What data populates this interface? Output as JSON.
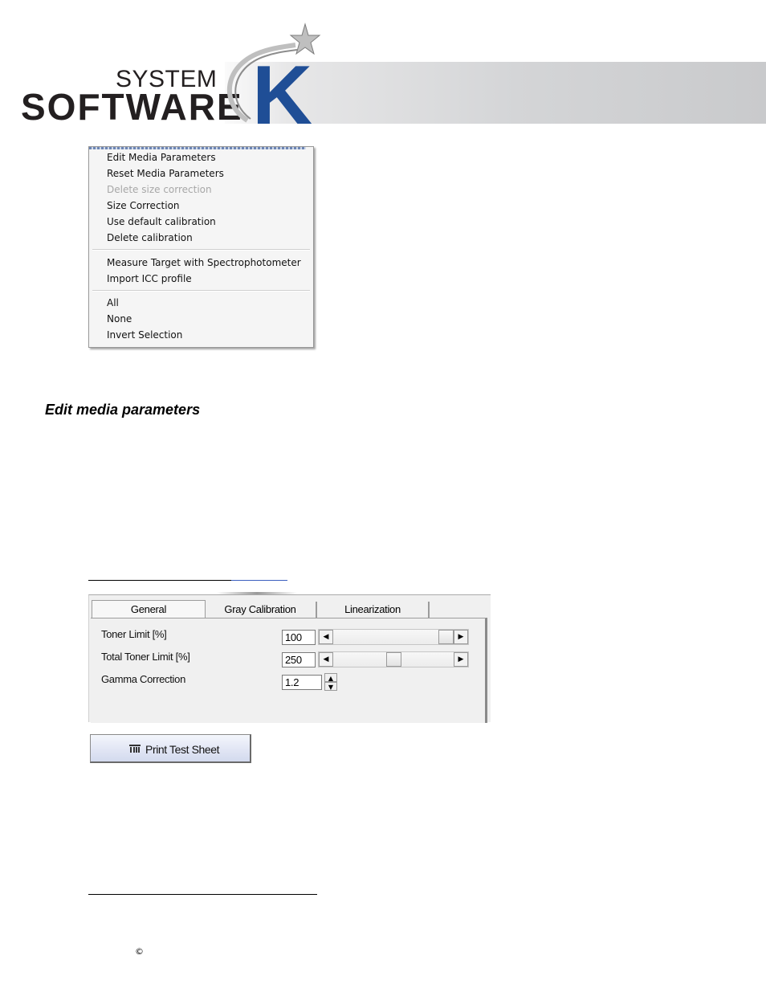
{
  "logo": {
    "line1": "SYSTEM",
    "line2": "SOFTWARE",
    "mark_letter": "K",
    "icon": "star-swoosh-icon",
    "colors": {
      "brand_blue": "#1f4e96",
      "text": "#231f20",
      "banner_gray": "#d0d1d3"
    }
  },
  "context_menu": {
    "groups": [
      [
        {
          "label": "Edit Media Parameters",
          "enabled": true
        },
        {
          "label": "Reset Media Parameters",
          "enabled": true
        },
        {
          "label": "Delete size correction",
          "enabled": false
        },
        {
          "label": "Size Correction",
          "enabled": true
        },
        {
          "label": "Use default calibration",
          "enabled": true
        },
        {
          "label": "Delete calibration",
          "enabled": true
        }
      ],
      [
        {
          "label": "Measure Target with Spectrophotometer",
          "enabled": true
        },
        {
          "label": "Import ICC profile",
          "enabled": true
        }
      ],
      [
        {
          "label": "All",
          "enabled": true
        },
        {
          "label": "None",
          "enabled": true
        },
        {
          "label": "Invert Selection",
          "enabled": true
        }
      ]
    ]
  },
  "section_heading": "Edit media parameters",
  "dialog": {
    "tabs": [
      {
        "label": "General",
        "active": true
      },
      {
        "label": "Gray Calibration",
        "active": false
      },
      {
        "label": "Linearization",
        "active": false
      }
    ],
    "fields": {
      "toner_limit": {
        "label": "Toner Limit [%]",
        "value": "100",
        "slider_fraction": 1.0
      },
      "total_toner_limit": {
        "label": "Total Toner Limit [%]",
        "value": "250",
        "slider_fraction": 0.5
      },
      "gamma_correction": {
        "label": "Gamma Correction",
        "value": "1.2"
      }
    }
  },
  "print_button": {
    "label": "Print Test Sheet",
    "icon": "print-test-sheet-icon"
  },
  "footer": {
    "copyright_symbol": "©"
  }
}
